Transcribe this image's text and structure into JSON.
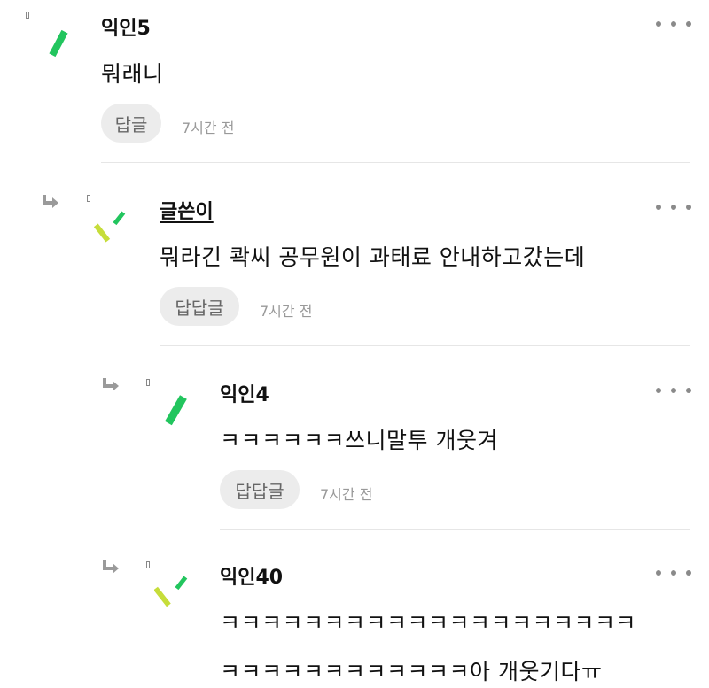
{
  "comments": [
    {
      "author": "익인5",
      "text": "뭐래니",
      "reply_label": "답글",
      "time": "7시간 전"
    },
    {
      "author": "글쓴이",
      "text": "뭐라긴 콱씨 공무원이 과태료 안내하고갔는데",
      "reply_label": "답답글",
      "time": "7시간 전"
    },
    {
      "author": "익인4",
      "text": "ㅋㅋㅋㅋㅋㅋ쓰니말투 개웃겨",
      "reply_label": "답답글",
      "time": "7시간 전"
    },
    {
      "author": "익인40",
      "text_line1": "ㅋㅋㅋㅋㅋㅋㅋㅋㅋㅋㅋㅋㅋㅋㅋㅋㅋㅋㅋㅋ",
      "text_line2": "ㅋㅋㅋㅋㅋㅋㅋㅋㅋㅋㅋㅋ아 개웃기다ㅠ"
    }
  ],
  "colors": {
    "avatar_green": "#22c55e",
    "avatar_lime": "#c6dd3a",
    "reply_bg": "#ececec",
    "time_gray": "#999999",
    "dots_gray": "#8a8a8a"
  },
  "icons": {
    "reply_arrow": "reply-arrow-icon",
    "more": "more-options-icon",
    "avatar": "generated-avatar"
  }
}
